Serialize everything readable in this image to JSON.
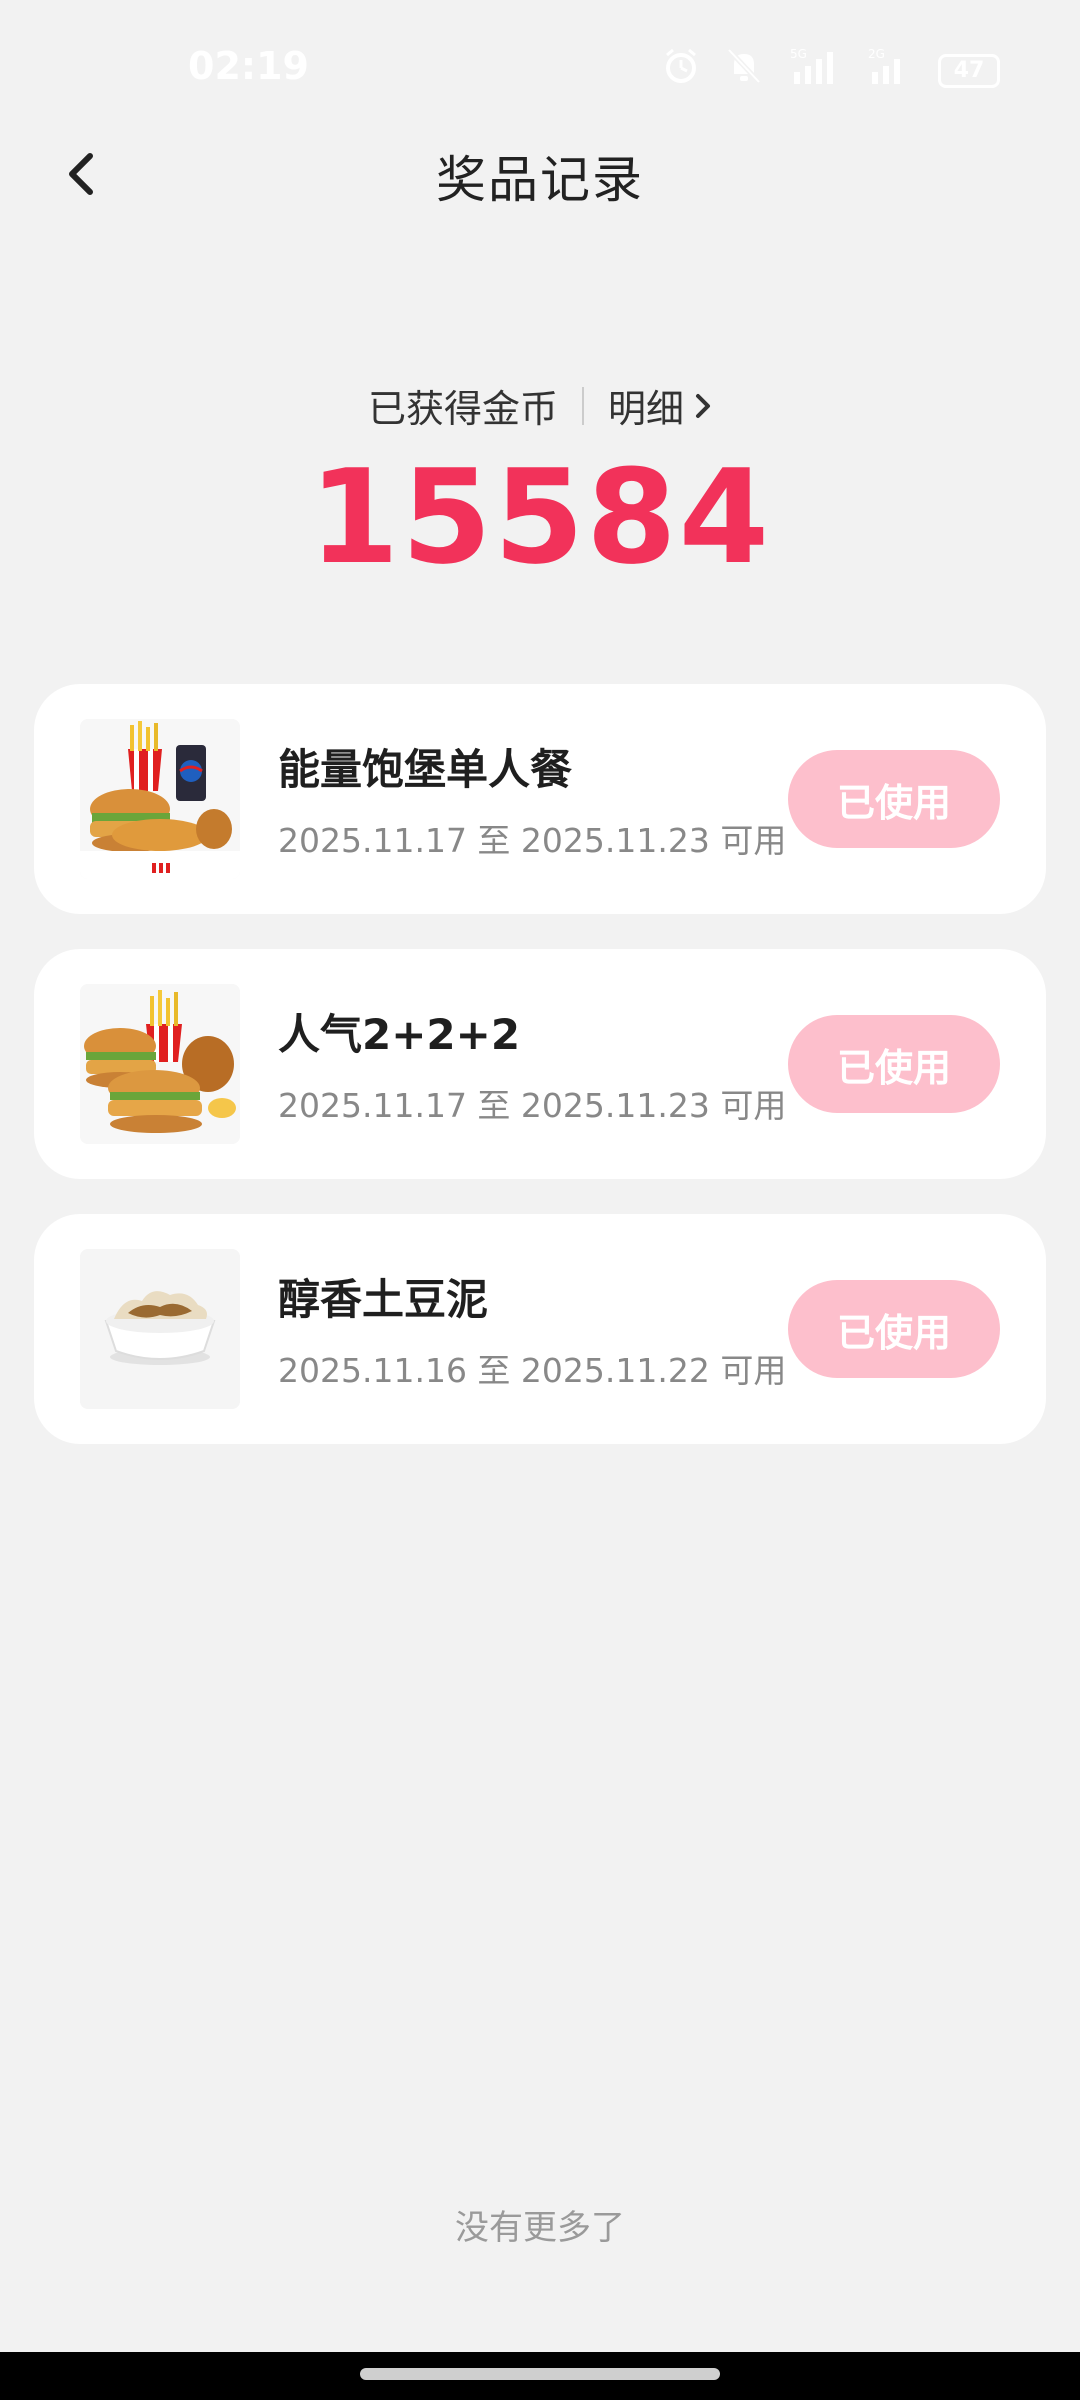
{
  "status_bar": {
    "time": "02:19",
    "network_label_1": "5G",
    "network_label_2": "2G",
    "battery": "47",
    "icons": [
      "alarm-icon",
      "bell-off-icon",
      "signal-5g-icon",
      "signal-2g-icon",
      "battery-icon"
    ]
  },
  "header": {
    "title": "奖品记录",
    "back_icon": "chevron-left-icon"
  },
  "coins": {
    "label": "已获得金币",
    "detail_label": "明细",
    "value": "15584",
    "accent_color": "#f2325a"
  },
  "prizes": [
    {
      "name": "能量饱堡单人餐",
      "validity": "2025.11.17 至 2025.11.23 可用",
      "status": "已使用",
      "image": "burger-meal-image"
    },
    {
      "name": "人气2+2+2",
      "validity": "2025.11.17 至 2025.11.23 可用",
      "status": "已使用",
      "image": "burger-combo-image"
    },
    {
      "name": "醇香土豆泥",
      "validity": "2025.11.16 至 2025.11.22 可用",
      "status": "已使用",
      "image": "mashed-potato-image"
    }
  ],
  "footer": {
    "no_more": "没有更多了"
  }
}
